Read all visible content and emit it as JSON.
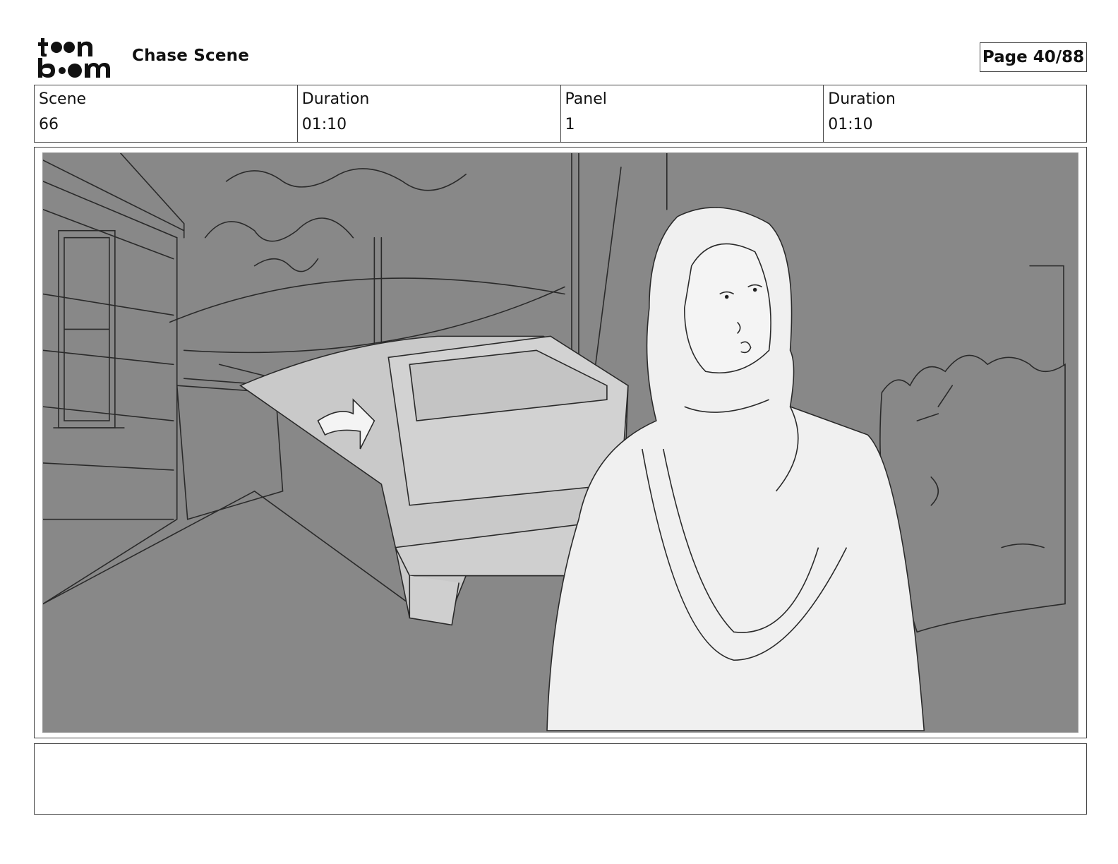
{
  "header": {
    "logo_text": "toon boom",
    "project_title": "Chase Scene",
    "page_label": "Page 40/88"
  },
  "info": {
    "scene_label": "Scene",
    "scene_value": "66",
    "scene_duration_label": "Duration",
    "scene_duration_value": "01:10",
    "panel_label": "Panel",
    "panel_value": "1",
    "panel_duration_label": "Duration",
    "panel_duration_value": "01:10"
  },
  "notes": {
    "text": ""
  },
  "colors": {
    "panel_background": "#888888",
    "figure_fill": "#f0f0f0",
    "truck_fill": "#c9c9c9",
    "line": "#2a2a2a"
  }
}
